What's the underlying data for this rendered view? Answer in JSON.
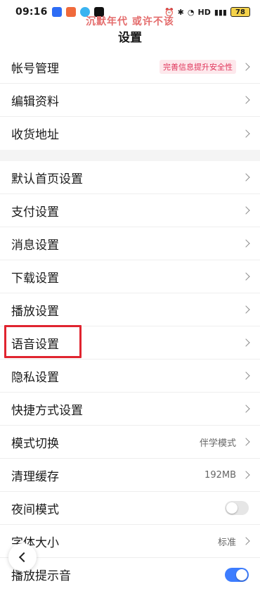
{
  "status_bar": {
    "time": "09:16",
    "battery": "78",
    "network": "HD",
    "app_icons": [
      "app-icon-1",
      "app-icon-2",
      "app-icon-3",
      "tiktok-icon"
    ]
  },
  "watermark": "沉默年代 或许不该",
  "page_title": "设置",
  "groups": [
    [
      {
        "label": "帐号管理",
        "badge": "完善信息提升安全性"
      },
      {
        "label": "编辑资料"
      },
      {
        "label": "收货地址"
      }
    ],
    [
      {
        "label": "默认首页设置"
      },
      {
        "label": "支付设置"
      },
      {
        "label": "消息设置"
      },
      {
        "label": "下载设置"
      },
      {
        "label": "播放设置"
      },
      {
        "label": "语音设置",
        "highlighted": true
      },
      {
        "label": "隐私设置"
      },
      {
        "label": "快捷方式设置"
      },
      {
        "label": "模式切换",
        "value": "伴学模式"
      },
      {
        "label": "清理缓存",
        "value": "192MB"
      },
      {
        "label": "夜间模式",
        "toggle": false
      },
      {
        "label": "字体大小",
        "value": "标准"
      },
      {
        "label": "播放提示音",
        "toggle": true
      }
    ]
  ],
  "colors": {
    "highlight_box": "#e0242f",
    "badge_text": "#e0345a",
    "toggle_on": "#3d7dff",
    "watermark": "#e46c6c"
  }
}
